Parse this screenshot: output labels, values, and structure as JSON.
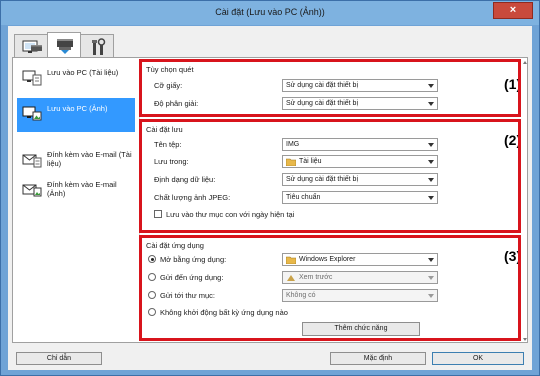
{
  "window": {
    "title": "Cài đặt (Lưu vào PC (Ảnh))",
    "close_label": "×"
  },
  "tabs": [
    {
      "name": "scan-from-computer-tab",
      "icon": "computer-scanner-icon"
    },
    {
      "name": "scan-from-operation-panel-tab",
      "icon": "scanner-icon"
    },
    {
      "name": "general-settings-tab",
      "icon": "tools-icon"
    }
  ],
  "sidebar": {
    "items": [
      {
        "label": "Lưu vào PC (Tài liệu)",
        "icon": "save-document-icon",
        "selected": false
      },
      {
        "label": "Lưu vào PC (Ảnh)",
        "icon": "save-photo-icon",
        "selected": true
      },
      {
        "label": "Đính kèm vào E-mail (Tài liệu)",
        "icon": "email-document-icon",
        "selected": false
      },
      {
        "label": "Đính kèm vào E-mail (Ảnh)",
        "icon": "email-photo-icon",
        "selected": false
      }
    ]
  },
  "scan_options": {
    "title": "Tùy chọn quét",
    "marker": "(1)",
    "paper_size": {
      "label": "Cỡ giấy:",
      "value": "Sử dụng cài đặt thiết bị"
    },
    "resolution": {
      "label": "Độ phân giải:",
      "value": "Sử dụng cài đặt thiết bị"
    }
  },
  "save_settings": {
    "title": "Cài đặt lưu",
    "marker": "(2)",
    "file_name": {
      "label": "Tên tệp:",
      "value": "IMG"
    },
    "save_in": {
      "label": "Lưu trong:",
      "value": "Tài liệu"
    },
    "data_format": {
      "label": "Định dạng dữ liệu:",
      "value": "Sử dụng cài đặt thiết bị"
    },
    "jpeg_quality": {
      "label": "Chất lượng ảnh JPEG:",
      "value": "Tiêu chuẩn"
    },
    "subfolder_checkbox": {
      "label": "Lưu vào thư mục con với ngày hiện tại",
      "checked": false
    }
  },
  "app_settings": {
    "title": "Cài đặt ứng dụng",
    "marker": "(3)",
    "open_with": {
      "label": "Mở bằng ứng dụng:",
      "value": "Windows Explorer",
      "selected": true
    },
    "send_to_app": {
      "label": "Gửi đến ứng dụng:",
      "value": "Xem trước",
      "selected": false
    },
    "send_to_folder": {
      "label": "Gửi tới thư mục:",
      "value": "Không có",
      "selected": false
    },
    "do_not_start": {
      "label": "Không khởi động bất kỳ ứng dụng nào",
      "selected": false
    },
    "more_functions_label": "Thêm chức năng"
  },
  "footer": {
    "help_label": "Chỉ dẫn",
    "defaults_label": "Mặc định",
    "ok_label": "OK"
  },
  "colors": {
    "titlebar": "#7eb2e0",
    "accent": "#3399ff",
    "highlight_red": "#d8141c",
    "close": "#c94a3c"
  }
}
